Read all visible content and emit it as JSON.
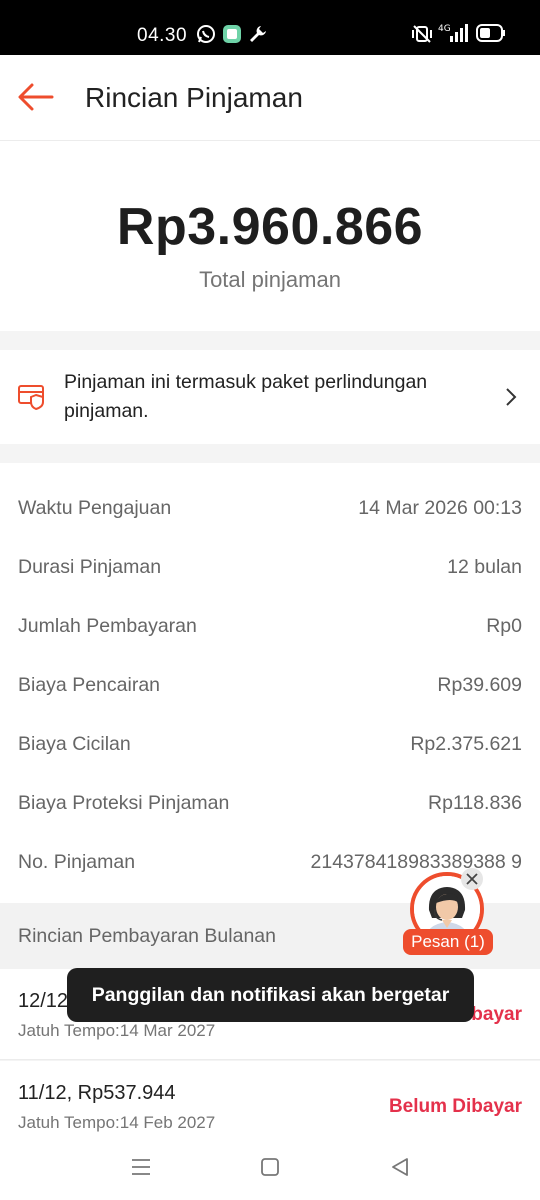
{
  "status_bar": {
    "time": "04.30",
    "icons": [
      "whatsapp-icon",
      "app-icon",
      "wrench-icon",
      "vibrate-icon",
      "signal-4g-icon",
      "battery-icon"
    ],
    "network_label": "4G"
  },
  "header": {
    "title": "Rincian Pinjaman",
    "back_icon": "arrow-left-icon"
  },
  "summary": {
    "amount": "Rp3.960.866",
    "label": "Total pinjaman"
  },
  "protection_banner": {
    "text": "Pinjaman ini termasuk paket perlindungan pinjaman.",
    "icon": "card-shield-icon"
  },
  "details": [
    {
      "key": "Waktu Pengajuan",
      "value": "14 Mar 2026 00:13"
    },
    {
      "key": "Durasi Pinjaman",
      "value": "12 bulan"
    },
    {
      "key": "Jumlah Pembayaran",
      "value": "Rp0"
    },
    {
      "key": "Biaya Pencairan",
      "value": "Rp39.609"
    },
    {
      "key": "Biaya Cicilan",
      "value": "Rp2.375.621"
    },
    {
      "key": "Biaya Proteksi Pinjaman",
      "value": "Rp118.836"
    },
    {
      "key": "No. Pinjaman",
      "value": "214378418983389388 9"
    }
  ],
  "monthly": {
    "heading": "Rincian Pembayaran Bulanan",
    "installments": [
      {
        "title": "12/12",
        "due": "Jatuh Tempo:14 Mar 2027",
        "status": "Belum Dibayar"
      },
      {
        "title": "11/12, Rp537.944",
        "due": "Jatuh Tempo:14 Feb 2027",
        "status": "Belum Dibayar"
      }
    ]
  },
  "toast": {
    "text": "Panggilan dan notifikasi akan bergetar"
  },
  "chat_widget": {
    "label": "Pesan (1)"
  },
  "colors": {
    "accent": "#ee4d2d",
    "status_red": "#e4314b",
    "muted": "#757575"
  }
}
